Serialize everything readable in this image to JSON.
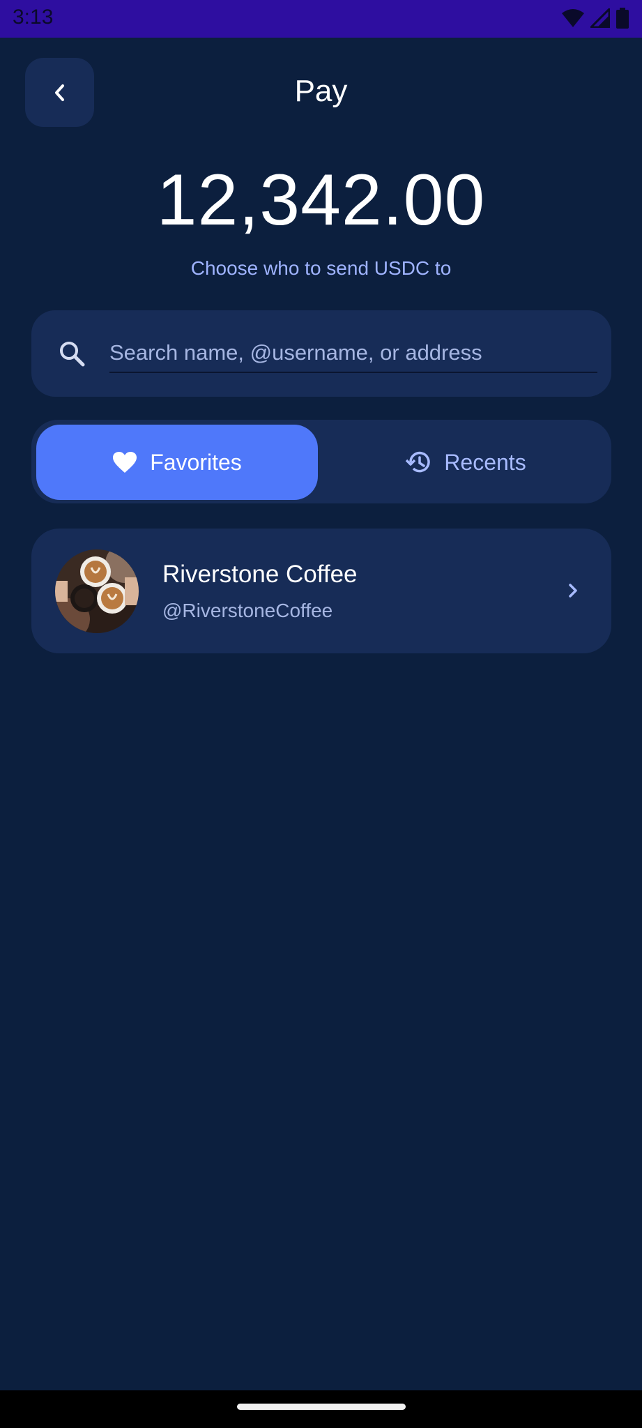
{
  "status_bar": {
    "time": "3:13",
    "icons": [
      "wifi-icon",
      "signal-icon",
      "battery-icon"
    ]
  },
  "header": {
    "back_icon": "chevron-left-icon",
    "title": "Pay"
  },
  "amount": {
    "value": "12,342.00",
    "subtitle": "Choose who to send USDC to"
  },
  "search": {
    "icon": "search-icon",
    "placeholder": "Search name, @username, or address",
    "value": ""
  },
  "tabs": [
    {
      "label": "Favorites",
      "icon": "heart-icon",
      "selected": true
    },
    {
      "label": "Recents",
      "icon": "history-icon",
      "selected": false
    }
  ],
  "contacts": [
    {
      "name": "Riverstone Coffee",
      "handle": "@RiverstoneCoffee",
      "avatar": "coffee-cups-photo",
      "icon": "chevron-right-icon"
    }
  ],
  "colors": {
    "background": "#0c1f3e",
    "card": "#172c57",
    "accent": "#4f78fa",
    "status_bar": "#2e0ea0",
    "muted_text": "#a6b6e2",
    "subtitle_text": "#9fb3ff"
  }
}
